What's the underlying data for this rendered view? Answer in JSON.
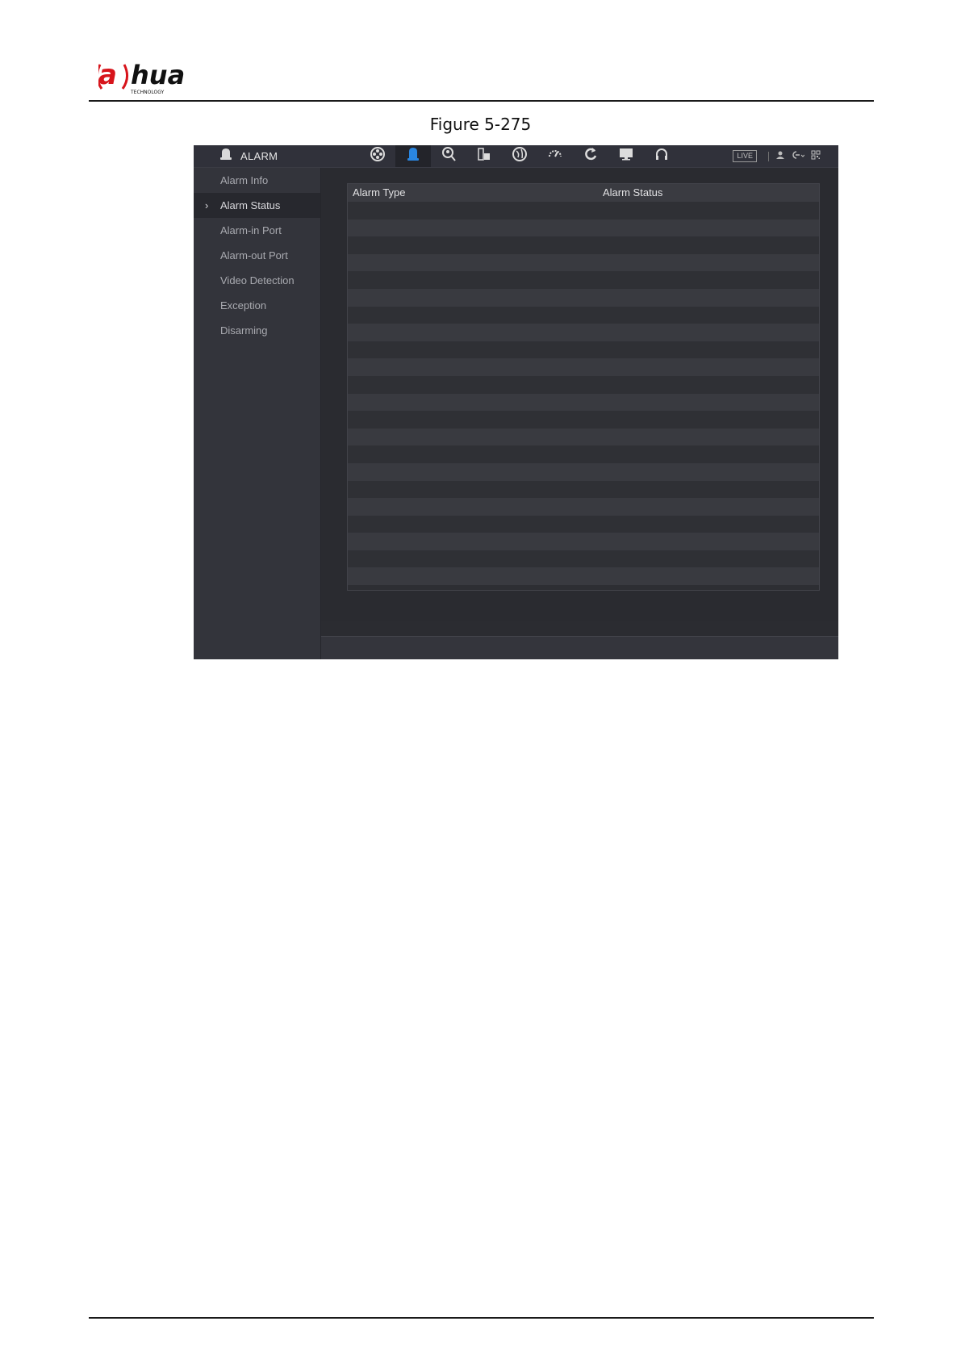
{
  "document": {
    "logo": {
      "brand": "alhua",
      "tagline": "TECHNOLOGY"
    },
    "figure_caption": "Figure 5-275"
  },
  "app": {
    "title": "ALARM",
    "title_icon": "alarm-bell-icon",
    "nav_icons": [
      {
        "name": "camera-reel-icon",
        "active": false
      },
      {
        "name": "alarm-light-icon",
        "active": true,
        "color": "#2a86e0"
      },
      {
        "name": "search-person-icon",
        "active": false
      },
      {
        "name": "storage-icon",
        "active": false
      },
      {
        "name": "network-globe-icon",
        "active": false
      },
      {
        "name": "speedometer-icon",
        "active": false
      },
      {
        "name": "refresh-icon",
        "active": false
      },
      {
        "name": "monitor-icon",
        "active": false
      },
      {
        "name": "headset-icon",
        "active": false
      }
    ],
    "right_tools": {
      "live_label": "LIVE",
      "icons": [
        "user-icon",
        "logout-icon",
        "qr-code-icon"
      ]
    },
    "sidebar": {
      "items": [
        {
          "label": "Alarm Info",
          "active": false
        },
        {
          "label": "Alarm Status",
          "active": true
        },
        {
          "label": "Alarm-in Port",
          "active": false
        },
        {
          "label": "Alarm-out Port",
          "active": false
        },
        {
          "label": "Video Detection",
          "active": false
        },
        {
          "label": "Exception",
          "active": false
        },
        {
          "label": "Disarming",
          "active": false
        }
      ]
    },
    "table": {
      "columns": [
        "Alarm Type",
        "Alarm Status"
      ],
      "rows": []
    }
  },
  "colors": {
    "accent_blue": "#2a86e0",
    "brand_red": "#d7141b"
  }
}
